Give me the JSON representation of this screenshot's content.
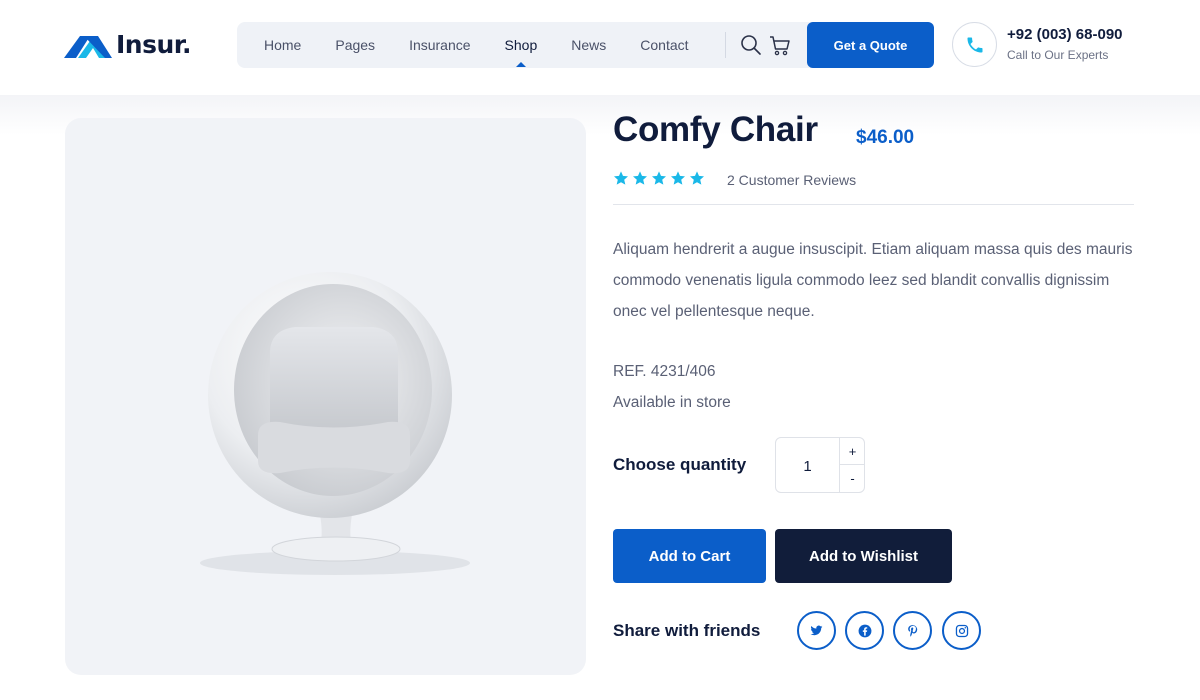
{
  "brand": {
    "name": "Insur.",
    "accent": "#0b5ec9",
    "dark": "#101c3c"
  },
  "nav": {
    "items": [
      {
        "label": "Home"
      },
      {
        "label": "Pages"
      },
      {
        "label": "Insurance"
      },
      {
        "label": "Shop",
        "active": true
      },
      {
        "label": "News"
      },
      {
        "label": "Contact"
      }
    ],
    "search_icon": "search-icon",
    "cart_icon": "cart-icon",
    "quote_label": "Get a Quote"
  },
  "contact": {
    "icon": "phone-icon",
    "number": "+92 (003) 68-090",
    "subtitle": "Call to Our Experts"
  },
  "product": {
    "title": "Comfy Chair",
    "price": "$46.00",
    "rating": 5,
    "rating_max": 5,
    "reviews_label": "2 Customer Reviews",
    "description": "Aliquam hendrerit a augue insuscipit. Etiam aliquam massa quis des mauris commodo venenatis ligula commodo leez sed blandit convallis dignissim onec vel pellentesque neque.",
    "ref": "REF. 4231/406",
    "availability": "Available in store",
    "quantity_label": "Choose quantity",
    "quantity": "1",
    "plus": "+",
    "minus": "-",
    "add_to_cart": "Add to Cart",
    "add_to_wishlist": "Add to Wishlist",
    "share_label": "Share with friends",
    "share_icons": [
      "twitter-icon",
      "facebook-icon",
      "pinterest-icon",
      "instagram-icon"
    ]
  },
  "colors": {
    "star": "#1ab8e8",
    "wish_button": "#111d3a"
  }
}
